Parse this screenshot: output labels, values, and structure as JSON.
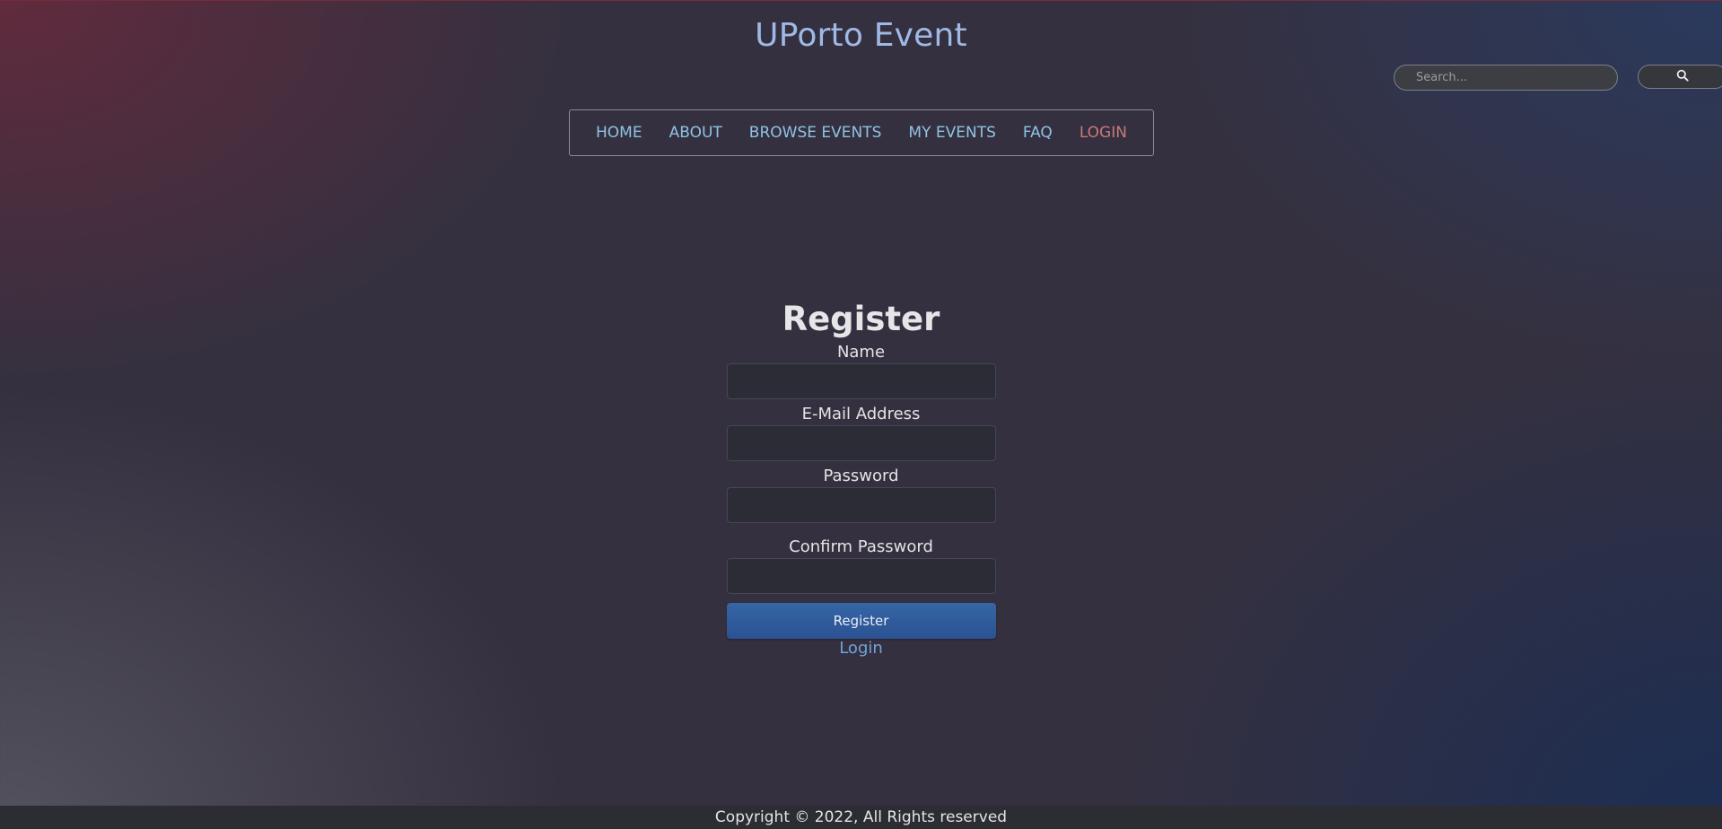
{
  "header": {
    "site_title": "UPorto Event"
  },
  "search": {
    "placeholder": "Search...",
    "button_icon": "search-icon"
  },
  "nav": {
    "items": [
      {
        "label": "HOME"
      },
      {
        "label": "ABOUT"
      },
      {
        "label": "BROWSE EVENTS"
      },
      {
        "label": "MY EVENTS"
      },
      {
        "label": "FAQ"
      },
      {
        "label": "LOGIN"
      }
    ]
  },
  "register_form": {
    "title": "Register",
    "name_label": "Name",
    "email_label": "E-Mail Address",
    "password_label": "Password",
    "confirm_password_label": "Confirm Password",
    "submit_label": "Register",
    "login_link": "Login"
  },
  "footer": {
    "copyright": "Copyright © 2022, All Rights reserved"
  },
  "colors": {
    "title": "#9fb9e6",
    "nav_link": "#8fc3e4",
    "nav_login": "#c97a7a",
    "button": "#2f5c9c"
  }
}
